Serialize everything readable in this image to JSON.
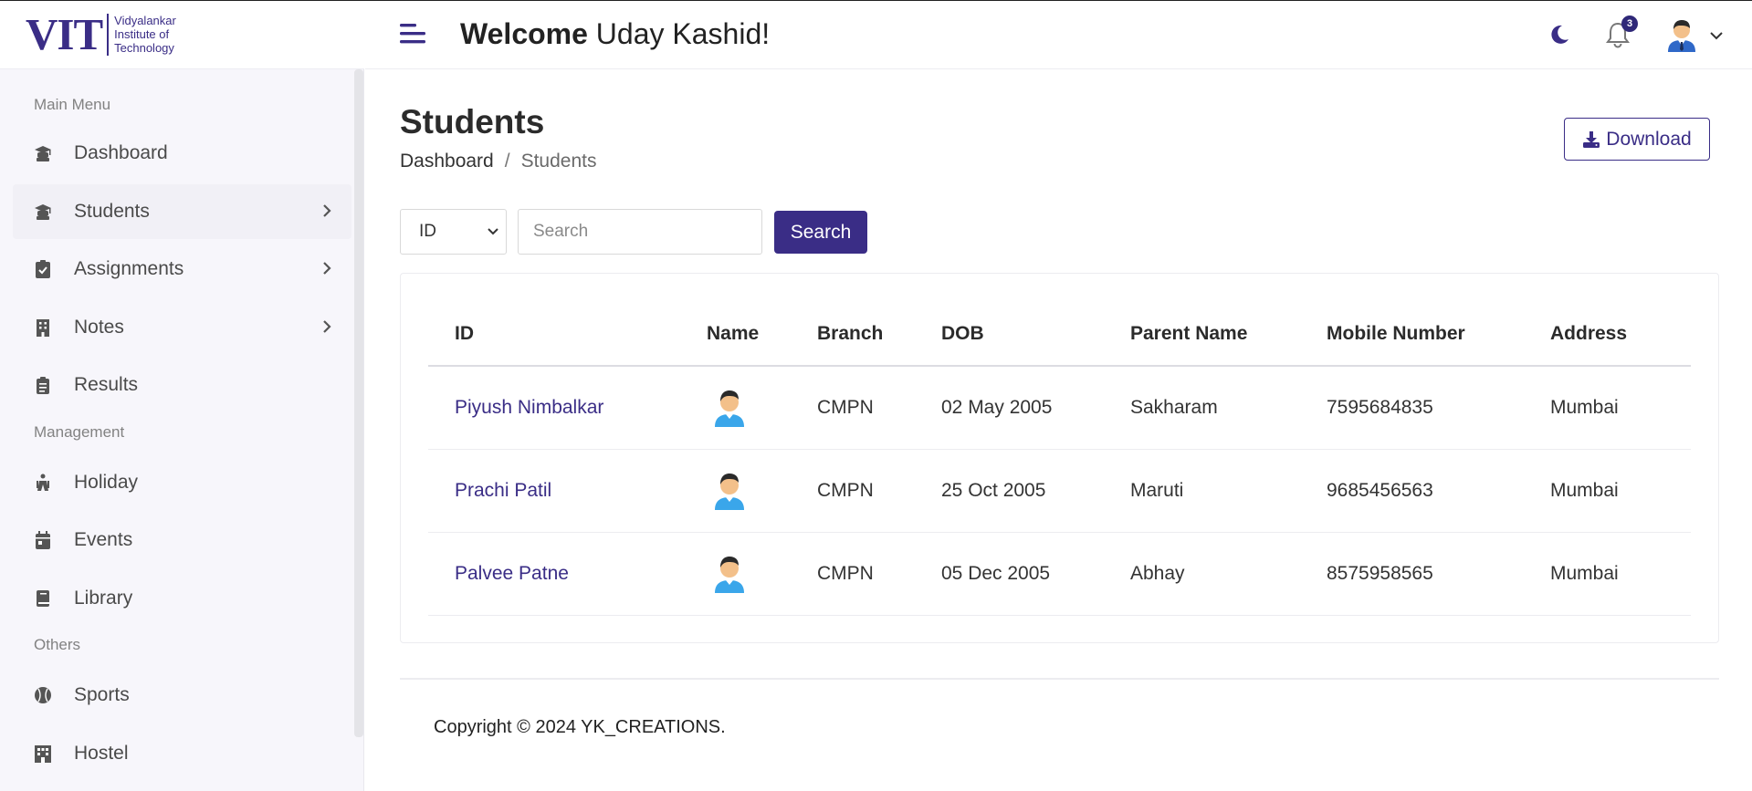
{
  "logo": {
    "big": "VIT",
    "line1": "Vidyalankar",
    "line2": "Institute  of",
    "line3": "Technology"
  },
  "sidebar": {
    "sections": [
      "Main Menu",
      "Management",
      "Others"
    ],
    "items": [
      {
        "label": "Dashboard",
        "icon": "graduate-icon"
      },
      {
        "label": "Students",
        "icon": "graduate-icon"
      },
      {
        "label": "Assignments",
        "icon": "clipboard-check-icon"
      },
      {
        "label": "Notes",
        "icon": "building-icon"
      },
      {
        "label": "Results",
        "icon": "clipboard-list-icon"
      },
      {
        "label": "Holiday",
        "icon": "holiday-icon"
      },
      {
        "label": "Events",
        "icon": "calendar-icon"
      },
      {
        "label": "Library",
        "icon": "book-icon"
      },
      {
        "label": "Sports",
        "icon": "baseball-icon"
      },
      {
        "label": "Hostel",
        "icon": "hotel-icon"
      }
    ]
  },
  "header": {
    "welcome_bold": "Welcome",
    "user_name": "Uday Kashid!",
    "notification_count": "3"
  },
  "main": {
    "title": "Students",
    "breadcrumb": {
      "home": "Dashboard",
      "sep": "/",
      "current": "Students"
    },
    "download_label": "Download",
    "filter": {
      "selected": "ID"
    },
    "search": {
      "placeholder": "Search",
      "button": "Search"
    }
  },
  "table": {
    "columns": [
      "ID",
      "Name",
      "Branch",
      "DOB",
      "Parent Name",
      "Mobile Number",
      "Address"
    ],
    "rows": [
      {
        "id": "Piyush Nimbalkar",
        "branch": "CMPN",
        "dob": "02 May 2005",
        "parent": "Sakharam",
        "mobile": "7595684835",
        "address": "Mumbai"
      },
      {
        "id": "Prachi Patil",
        "branch": "CMPN",
        "dob": "25 Oct 2005",
        "parent": "Maruti",
        "mobile": "9685456563",
        "address": "Mumbai"
      },
      {
        "id": "Palvee Patne",
        "branch": "CMPN",
        "dob": "05 Dec 2005",
        "parent": "Abhay",
        "mobile": "8575958565",
        "address": "Mumbai"
      }
    ]
  },
  "footer": {
    "copyright": "Copyright © 2024 YK_CREATIONS."
  },
  "colors": {
    "accent": "#3a2d86",
    "sidebar_bg": "#f7f6fb",
    "icon_gray": "#555555"
  }
}
